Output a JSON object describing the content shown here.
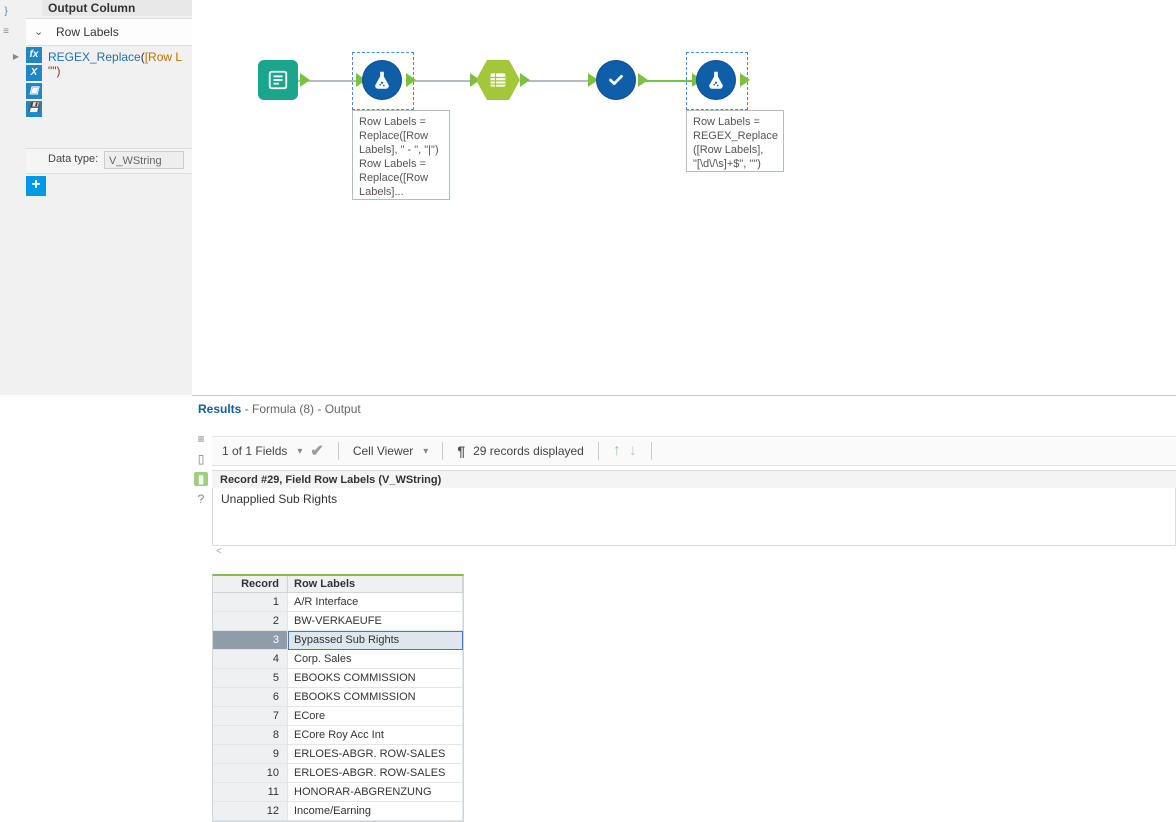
{
  "config": {
    "header": "Output Column",
    "selected_field": "Row Labels",
    "expression_fn": "REGEX_Replace",
    "expression_field": "[Row L",
    "expression_line2": "\"\")",
    "data_type_label": "Data type:",
    "data_type_value": "V_WString",
    "add_symbol": "+"
  },
  "workflow": {
    "annotation1_l1": "Row Labels =",
    "annotation1_l2": "Replace([Row",
    "annotation1_l3": "Labels], \" - \", \"|\")",
    "annotation1_l4": "Row Labels =",
    "annotation1_l5": "Replace([Row",
    "annotation1_l6": "Labels]...",
    "annotation2_l1": "Row Labels =",
    "annotation2_l2": "REGEX_Replace",
    "annotation2_l3": "([Row Labels],",
    "annotation2_l4": "\"[\\d\\/\\s]+$\", \"\")"
  },
  "results": {
    "title_bold": "Results",
    "title_rest": " - Formula (8) - Output",
    "fields_text": "1 of 1 Fields",
    "cell_viewer": "Cell Viewer",
    "records_text": "29 records displayed",
    "record_title": "Record #29, Field Row Labels (V_WString)",
    "record_value": "Unapplied Sub Rights",
    "col_record": "Record",
    "col_rowlabels": "Row Labels",
    "rows": [
      {
        "n": "1",
        "v": "A/R Interface"
      },
      {
        "n": "2",
        "v": "BW-VERKAEUFE"
      },
      {
        "n": "3",
        "v": "Bypassed Sub Rights"
      },
      {
        "n": "4",
        "v": "Corp. Sales"
      },
      {
        "n": "5",
        "v": "EBOOKS COMMISSION"
      },
      {
        "n": "6",
        "v": "EBOOKS COMMISSION"
      },
      {
        "n": "7",
        "v": "ECore"
      },
      {
        "n": "8",
        "v": "ECore Roy Acc Int"
      },
      {
        "n": "9",
        "v": "ERLOES-ABGR. ROW-SALES"
      },
      {
        "n": "10",
        "v": "ERLOES-ABGR. ROW-SALES"
      },
      {
        "n": "11",
        "v": "HONORAR-ABGRENZUNG"
      },
      {
        "n": "12",
        "v": "Income/Earning"
      }
    ],
    "selected_row_index": 2
  }
}
